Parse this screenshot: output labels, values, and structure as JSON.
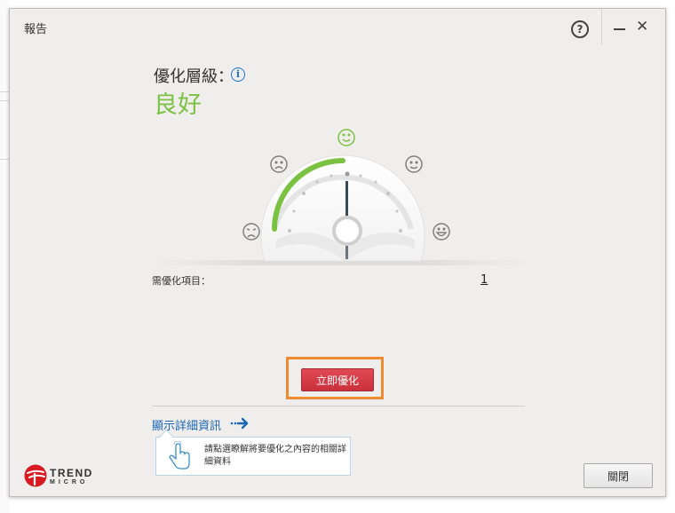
{
  "window": {
    "title": "報告",
    "help_label": "?",
    "close_label": "✕"
  },
  "optimization": {
    "label": "優化層級：",
    "value": "良好",
    "info_label": "i"
  },
  "items": {
    "label": "需優化項目：",
    "count": "1"
  },
  "actions": {
    "optimize_now": "立即優化",
    "show_details": "顯示詳細資訊",
    "close": "關閉"
  },
  "tip": {
    "text": "請點選瞭解將要優化之內容的相關詳細資料"
  },
  "brand": {
    "line1": "TREND",
    "line2": "MICRO"
  },
  "gauge": {
    "level": 0.5,
    "faces": [
      "angry",
      "sad",
      "happy",
      "neutral",
      "grin"
    ]
  },
  "colors": {
    "accent_green": "#7cc242",
    "optimize_red": "#d63a45",
    "highlight_orange": "#f08a2e",
    "link_blue": "#1a66b3"
  }
}
